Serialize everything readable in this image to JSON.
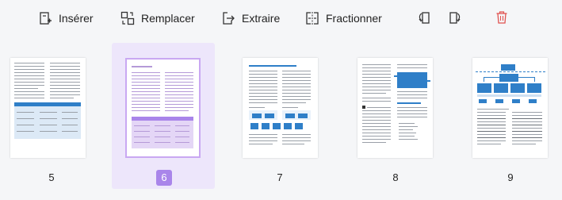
{
  "toolbar": {
    "insert_label": "Insérer",
    "replace_label": "Remplacer",
    "extract_label": "Extraire",
    "split_label": "Fractionner"
  },
  "icons": {
    "insert": "insert-page-icon",
    "replace": "replace-page-icon",
    "extract": "extract-page-icon",
    "split": "split-page-icon",
    "rotate_left": "rotate-left-icon",
    "rotate_right": "rotate-right-icon",
    "delete": "trash-icon"
  },
  "pages": [
    {
      "number": "5",
      "selected": false
    },
    {
      "number": "6",
      "selected": true
    },
    {
      "number": "7",
      "selected": false
    },
    {
      "number": "8",
      "selected": false
    },
    {
      "number": "9",
      "selected": false
    }
  ],
  "colors": {
    "accent": "#a985ea",
    "selection_bg": "#ede6fb",
    "delete": "#e0524f",
    "doc_blue": "#2f7fc8"
  }
}
